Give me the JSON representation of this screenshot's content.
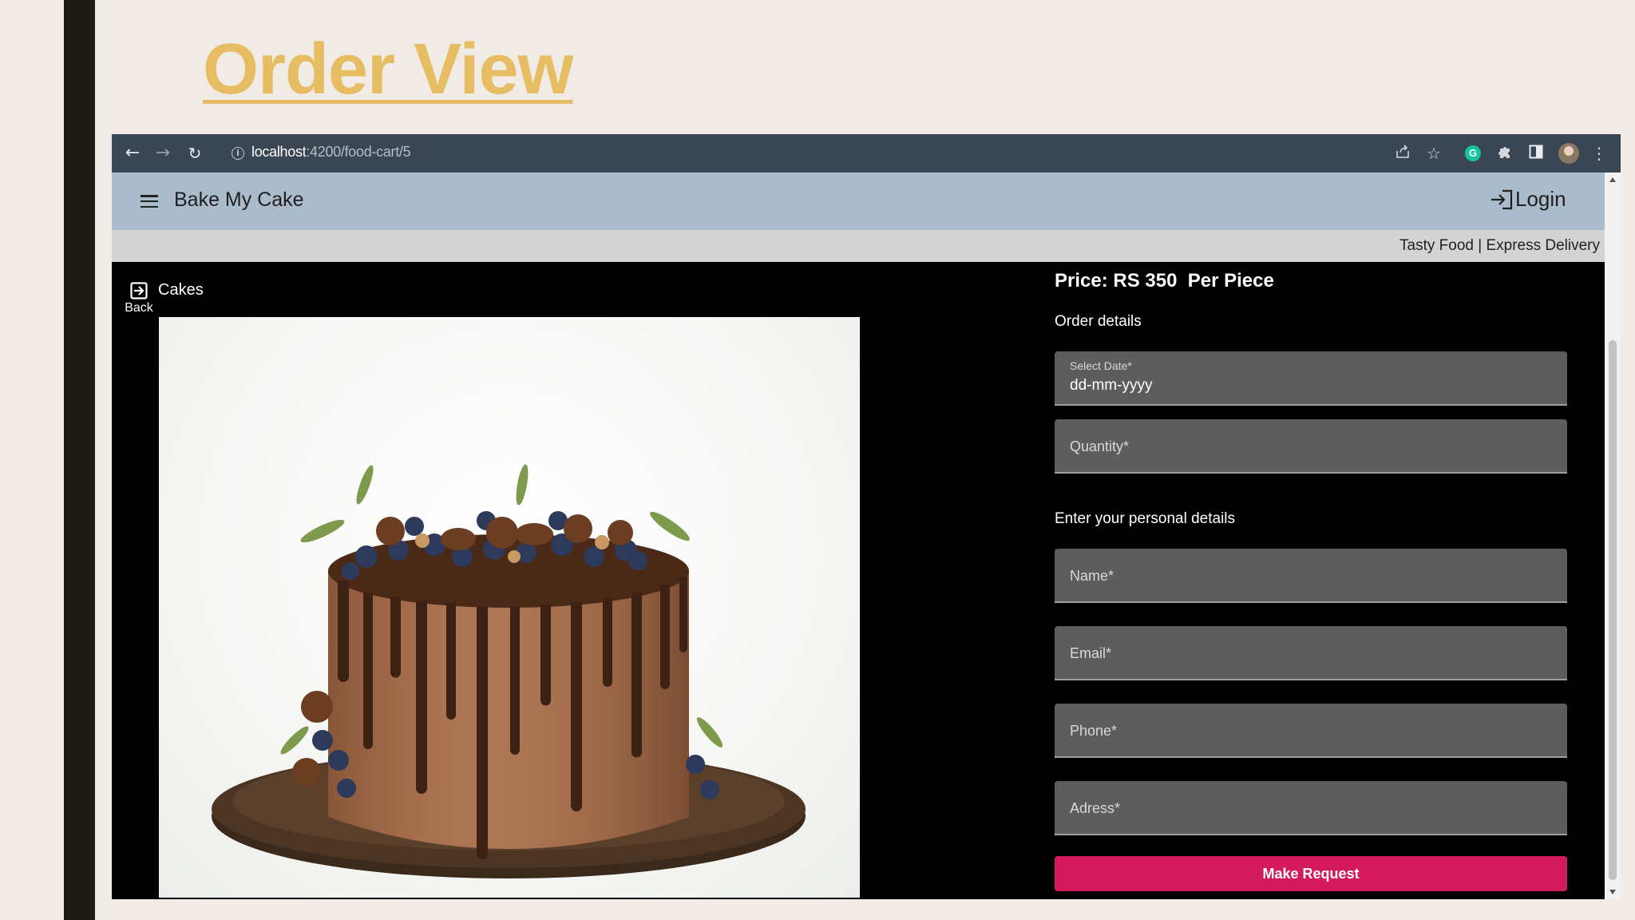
{
  "slide": {
    "title": "Order View"
  },
  "browser": {
    "url_host": "localhost",
    "url_rest": ":4200/food-cart/5"
  },
  "app": {
    "title": "Bake My Cake",
    "login_label": "Login",
    "marquee": "Tasty Food | Express Delivery"
  },
  "nav": {
    "back_label": "Back",
    "category": "Cakes"
  },
  "order": {
    "price": "Price: RS 350  Per Piece",
    "order_details_heading": "Order details",
    "date_label": "Select Date*",
    "date_value": "dd-mm-yyyy",
    "quantity_label": "Quantity*",
    "personal_heading": "Enter your personal details",
    "name_label": "Name*",
    "email_label": "Email*",
    "phone_label": "Phone*",
    "address_label": "Adress*",
    "submit_label": "Make Request"
  },
  "colors": {
    "title_gold": "#e6bd63",
    "header_bg": "#aabbcb",
    "button_pink": "#d41a5c",
    "field_bg": "#5d5d5d"
  },
  "icons": [
    "back-arrow-icon",
    "forward-arrow-icon",
    "reload-icon",
    "info-icon",
    "share-icon",
    "star-icon",
    "grammarly-icon",
    "extensions-icon",
    "sidebar-icon",
    "profile-avatar",
    "more-icon",
    "menu-icon",
    "login-icon",
    "back-exit-icon"
  ]
}
